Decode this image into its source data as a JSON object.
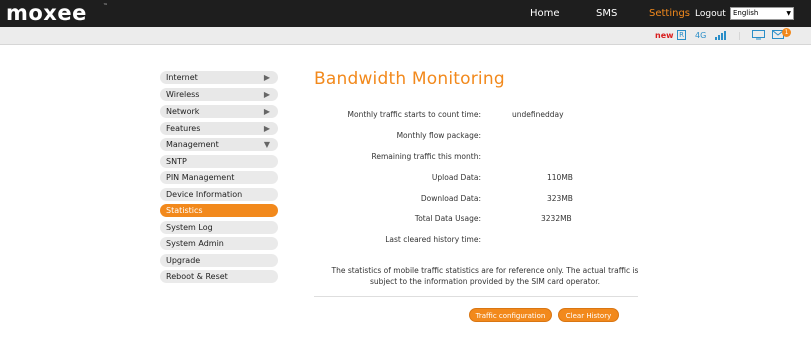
{
  "header": {
    "logo": "moxee",
    "logo_mark": "™",
    "nav": [
      {
        "label": "Home",
        "active": false
      },
      {
        "label": "SMS",
        "active": false
      },
      {
        "label": "Settings",
        "active": true
      }
    ],
    "logout": "Logout",
    "language": "English"
  },
  "status_bar": {
    "new_label": "new",
    "roaming_label": "R",
    "network_label": "4G",
    "signal_icon": "signal-bars-icon",
    "divider": "|",
    "mail_badge": "1"
  },
  "sidebar": {
    "items": [
      {
        "label": "Internet",
        "caret": "▶"
      },
      {
        "label": "Wireless",
        "caret": "▶"
      },
      {
        "label": "Network",
        "caret": "▶"
      },
      {
        "label": "Features",
        "caret": "▶"
      },
      {
        "label": "Management",
        "caret": "▼"
      }
    ],
    "sub_items": [
      {
        "label": "SNTP"
      },
      {
        "label": "PIN Management"
      },
      {
        "label": "Device Information"
      },
      {
        "label": "Statistics",
        "active": true
      },
      {
        "label": "System Log"
      },
      {
        "label": "System Admin"
      },
      {
        "label": "Upgrade"
      },
      {
        "label": "Reboot & Reset"
      }
    ]
  },
  "main": {
    "title": "Bandwidth Monitoring",
    "rows": [
      {
        "label": "Monthly traffic starts to count time:",
        "value": "undefinedday"
      },
      {
        "label": "Monthly flow package:",
        "value": ""
      },
      {
        "label": "Remaining traffic this month:",
        "value": ""
      },
      {
        "label": "Upload Data:",
        "value": "110MB"
      },
      {
        "label": "Download Data:",
        "value": "323MB"
      },
      {
        "label": "Total Data Usage:",
        "value": "3232MB"
      },
      {
        "label": "Last cleared history time:",
        "value": ""
      }
    ],
    "note": "The statistics of mobile traffic statistics are for reference only. The actual traffic is subject to the information provided by the SIM card operator.",
    "buttons": {
      "traffic_config": "Traffic configuration",
      "clear_history": "Clear History"
    }
  },
  "colors": {
    "accent": "#f2891c",
    "topbar": "#1e1e1e",
    "status_blue": "#2a8ec8",
    "new_red": "#d81d1d"
  }
}
